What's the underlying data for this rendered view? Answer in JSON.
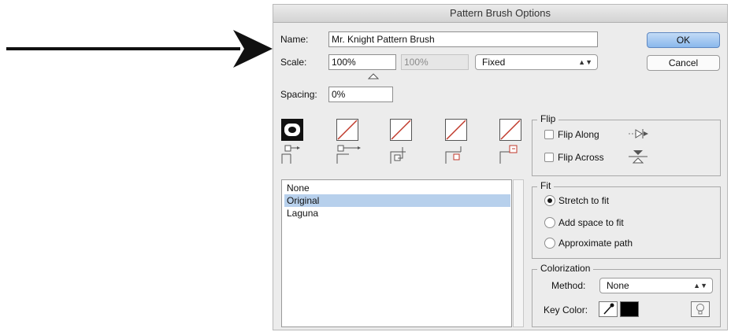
{
  "window": {
    "title": "Pattern Brush Options"
  },
  "name": {
    "label": "Name:",
    "value": "Mr. Knight Pattern Brush"
  },
  "scale": {
    "label": "Scale:",
    "value": "100%",
    "value2": "100%",
    "mode": "Fixed"
  },
  "spacing": {
    "label": "Spacing:",
    "value": "0%"
  },
  "buttons": {
    "ok": "OK",
    "cancel": "Cancel"
  },
  "tiles": [
    "side-tile",
    "outer-corner-tile",
    "inner-corner-tile",
    "start-tile",
    "end-tile"
  ],
  "patterns": {
    "items": [
      "None",
      "Original",
      "Laguna"
    ],
    "selected_index": 1
  },
  "flip": {
    "title": "Flip",
    "along": "Flip Along",
    "across": "Flip Across"
  },
  "fit": {
    "title": "Fit",
    "options": [
      "Stretch to fit",
      "Add space to fit",
      "Approximate path"
    ],
    "selected_index": 0
  },
  "colorization": {
    "title": "Colorization",
    "method_label": "Method:",
    "method_value": "None",
    "key_color_label": "Key Color:"
  },
  "colors": {
    "accent": "#b7d0ec",
    "default_button": "#8ab8ec",
    "tile_slash": "#c0392b",
    "key_color": "#000000"
  }
}
